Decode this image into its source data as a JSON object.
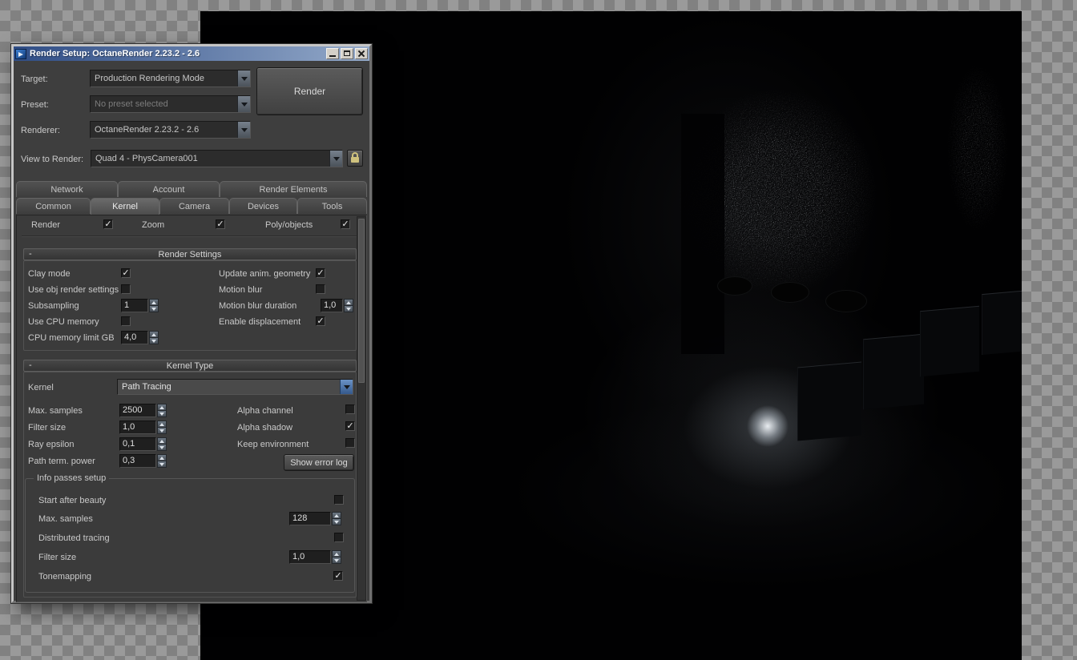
{
  "ui": {
    "check_glyph": "✓",
    "collapse_glyph": "-"
  },
  "colors": {
    "dialog_bg": "#3e3e3e",
    "titlebar_left": "#2f4d86",
    "titlebar_right": "#93a9c9",
    "accent_blue": "#35598c"
  },
  "window": {
    "title": "Render Setup: OctaneRender 2.23.2 - 2.6"
  },
  "header": {
    "target_label": "Target:",
    "target_value": "Production Rendering Mode",
    "preset_label": "Preset:",
    "preset_value": "No preset selected",
    "renderer_label": "Renderer:",
    "renderer_value": "OctaneRender 2.23.2 - 2.6",
    "view_label": "View to Render:",
    "view_value": "Quad 4 - PhysCamera001",
    "render_button": "Render"
  },
  "tabs": {
    "row1": [
      {
        "label": "Network"
      },
      {
        "label": "Account"
      },
      {
        "label": "Render Elements"
      }
    ],
    "row2": [
      {
        "label": "Common"
      },
      {
        "label": "Kernel",
        "active": true
      },
      {
        "label": "Camera"
      },
      {
        "label": "Devices"
      },
      {
        "label": "Tools"
      }
    ]
  },
  "clipped_row": {
    "items": [
      {
        "label": "Render",
        "checked": true
      },
      {
        "label": "Zoom",
        "checked": true
      },
      {
        "label": "Poly/objects",
        "checked": true
      }
    ]
  },
  "render_settings": {
    "title": "Render Settings",
    "clay_mode": {
      "label": "Clay mode",
      "checked": true
    },
    "use_obj": {
      "label": "Use obj render settings",
      "checked": false
    },
    "subsampling": {
      "label": "Subsampling",
      "value": "1"
    },
    "use_cpu": {
      "label": "Use CPU memory",
      "checked": false
    },
    "cpu_limit": {
      "label": "CPU memory limit GB",
      "value": "4,0"
    },
    "update_anim": {
      "label": "Update anim. geometry",
      "checked": true
    },
    "motion_blur": {
      "label": "Motion blur",
      "checked": false
    },
    "motion_blur_duration": {
      "label": "Motion blur duration",
      "value": "1,0"
    },
    "enable_displacement": {
      "label": "Enable displacement",
      "checked": true
    }
  },
  "kernel_type": {
    "title": "Kernel Type",
    "kernel_label": "Kernel",
    "kernel_value": "Path Tracing",
    "max_samples": {
      "label": "Max. samples",
      "value": "2500"
    },
    "filter_size": {
      "label": "Filter size",
      "value": "1,0"
    },
    "ray_epsilon": {
      "label": "Ray epsilon",
      "value": "0,1"
    },
    "path_term_power": {
      "label": "Path term. power",
      "value": "0,3"
    },
    "alpha_channel": {
      "label": "Alpha channel",
      "checked": false
    },
    "alpha_shadow": {
      "label": "Alpha shadow",
      "checked": true
    },
    "keep_environment": {
      "label": "Keep environment",
      "checked": false
    },
    "show_error_log": "Show error log",
    "info_passes": {
      "title": "Info passes setup",
      "start_after_beauty": {
        "label": "Start after beauty",
        "checked": false
      },
      "max_samples": {
        "label": "Max. samples",
        "value": "128"
      },
      "distributed_tracing": {
        "label": "Distributed tracing",
        "checked": false
      },
      "filter_size": {
        "label": "Filter size",
        "value": "1,0"
      },
      "tonemapping": {
        "label": "Tonemapping",
        "checked": true
      }
    }
  }
}
